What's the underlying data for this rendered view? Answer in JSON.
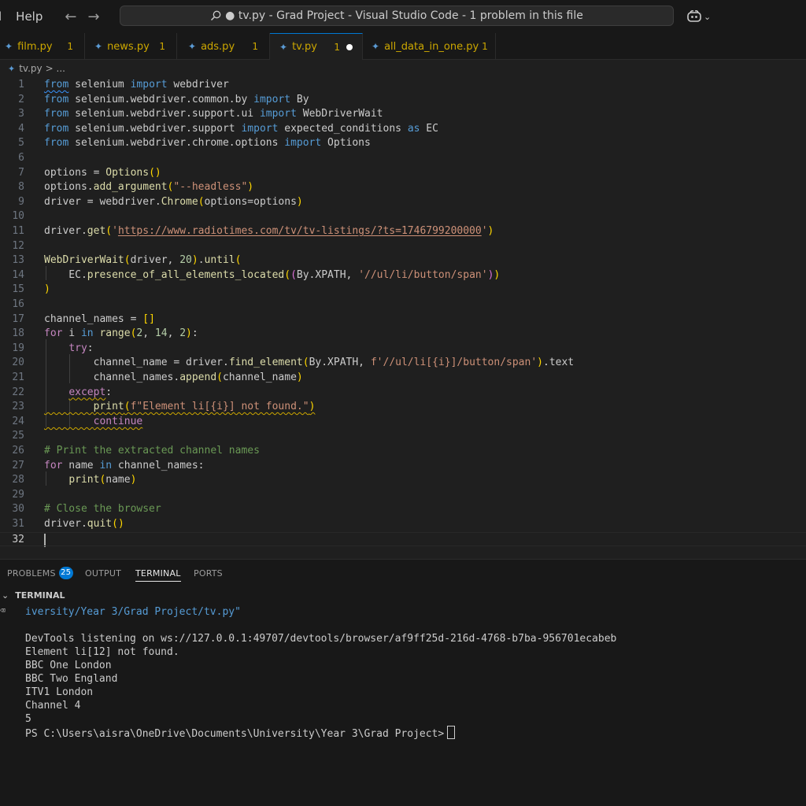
{
  "titlebar": {
    "menu_partial": "l",
    "menu_help": "Help",
    "search_text": "● tv.py - Grad Project - Visual Studio Code - 1 problem in this file",
    "back_icon": "arrow-left-icon",
    "forward_icon": "arrow-right-icon"
  },
  "tabs": [
    {
      "label": "film.py",
      "count": "1"
    },
    {
      "label": "news.py",
      "count": "1"
    },
    {
      "label": "ads.py",
      "count": "1"
    },
    {
      "label": "tv.py",
      "count": "1"
    },
    {
      "label": "all_data_in_one.py",
      "count": "1"
    }
  ],
  "breadcrumb": {
    "file": "tv.py",
    "rest": "> ..."
  },
  "editor": {
    "line_numbers": [
      "1",
      "2",
      "3",
      "4",
      "5",
      "6",
      "7",
      "8",
      "9",
      "10",
      "11",
      "12",
      "13",
      "14",
      "15",
      "16",
      "17",
      "18",
      "19",
      "20",
      "21",
      "22",
      "23",
      "24",
      "25",
      "26",
      "27",
      "28",
      "29",
      "30",
      "31",
      "32"
    ],
    "lines": [
      "from selenium import webdriver",
      "from selenium.webdriver.common.by import By",
      "from selenium.webdriver.support.ui import WebDriverWait",
      "from selenium.webdriver.support import expected_conditions as EC",
      "from selenium.webdriver.chrome.options import Options",
      "",
      "options = Options()",
      "options.add_argument(\"--headless\")",
      "driver = webdriver.Chrome(options=options)",
      "",
      "driver.get('https://www.radiotimes.com/tv/tv-listings/?ts=1746799200000')",
      "",
      "WebDriverWait(driver, 20).until(",
      "    EC.presence_of_all_elements_located((By.XPATH, '//ul/li/button/span'))",
      ")",
      "",
      "channel_names = []",
      "for i in range(2, 14, 2):",
      "    try:",
      "        channel_name = driver.find_element(By.XPATH, f'//ul/li[{i}]/button/span').text",
      "        channel_names.append(channel_name)",
      "    except:",
      "        print(f\"Element li[{i}] not found.\")",
      "        continue",
      "",
      "# Print the extracted channel names",
      "for name in channel_names:",
      "    print(name)",
      "",
      "# Close the browser",
      "driver.quit()",
      ""
    ],
    "current_line": 32
  },
  "panel": {
    "tabs": [
      "PROBLEMS",
      "OUTPUT",
      "TERMINAL",
      "PORTS"
    ],
    "problems_count": "25",
    "active_tab": "TERMINAL",
    "section_title": "TERMINAL"
  },
  "terminal": {
    "lines": [
      "iversity/Year 3/Grad Project/tv.py\"",
      "",
      "DevTools listening on ws://127.0.0.1:49707/devtools/browser/af9ff25d-216d-4768-b7ba-956701ecabeb",
      "Element li[12] not found.",
      "BBC One London",
      "BBC Two England",
      "ITV1 London",
      "Channel 4",
      "5"
    ],
    "prompt": "PS C:\\Users\\aisra\\OneDrive\\Documents\\University\\Year 3\\Grad Project>"
  },
  "colors": {
    "accent": "#0078d4",
    "warning": "#cca700",
    "keyword": "#569cd6",
    "control": "#c586c0",
    "string": "#ce9178",
    "comment": "#6a9955"
  }
}
